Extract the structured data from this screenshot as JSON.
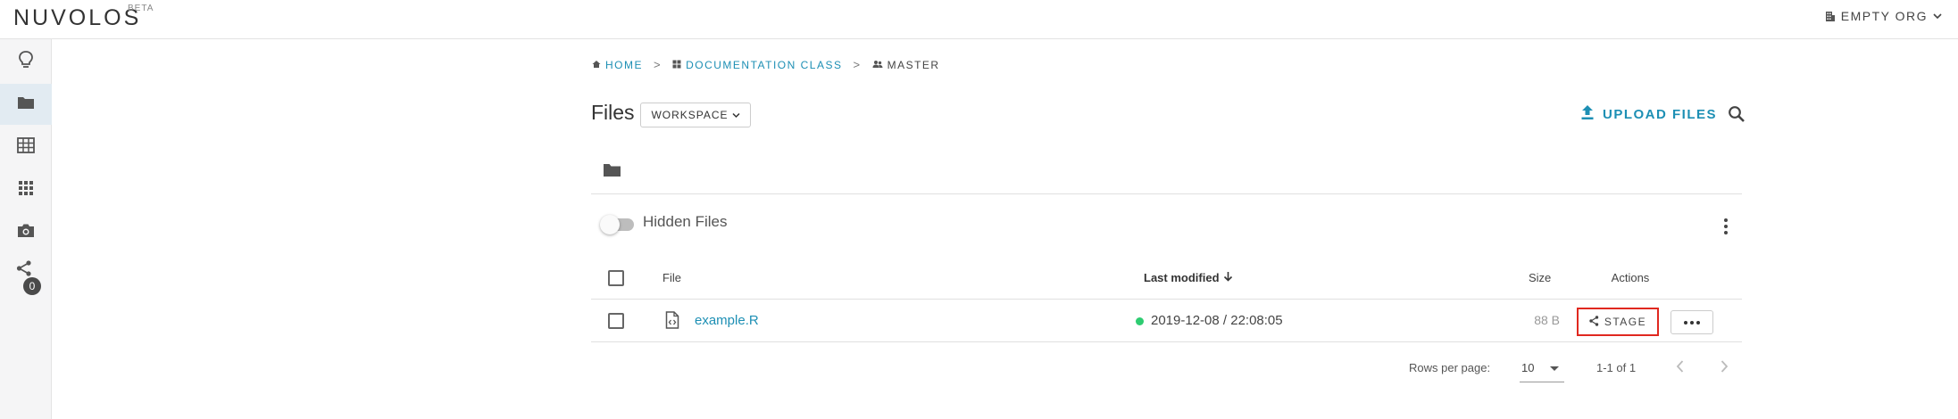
{
  "app": {
    "logo": "NUVOLOS",
    "logo_badge": "BETA",
    "org_label": "EMPTY ORG"
  },
  "sidebar": {
    "items": [
      {
        "icon": "lightbulb-icon",
        "active": false
      },
      {
        "icon": "folder-icon",
        "active": true
      },
      {
        "icon": "table-icon",
        "active": false
      },
      {
        "icon": "apps-grid-icon",
        "active": false
      },
      {
        "icon": "camera-icon",
        "active": false
      },
      {
        "icon": "share-icon",
        "active": false,
        "badge": "0"
      }
    ]
  },
  "breadcrumb": {
    "home": "HOME",
    "class": "DOCUMENTATION CLASS",
    "instance": "MASTER",
    "separator": ">"
  },
  "files": {
    "title": "Files",
    "workspace_label": "WORKSPACE",
    "upload_label": "UPLOAD FILES",
    "hidden_files_label": "Hidden Files",
    "hidden_files_enabled": false
  },
  "table": {
    "headers": {
      "file": "File",
      "last_modified": "Last modified",
      "size": "Size",
      "actions": "Actions"
    },
    "rows": [
      {
        "name": "example.R",
        "modified": "2019-12-08 / 22:08:05",
        "size": "88 B",
        "stage_label": "STAGE",
        "status_color": "#2ecc71"
      }
    ]
  },
  "pagination": {
    "rows_per_page_label": "Rows per page:",
    "rows_per_page_value": "10",
    "range": "1-1 of 1"
  },
  "colors": {
    "accent": "#1d8fb4",
    "highlight": "#e0281f",
    "sidebar_active": "#e2ebf2"
  }
}
